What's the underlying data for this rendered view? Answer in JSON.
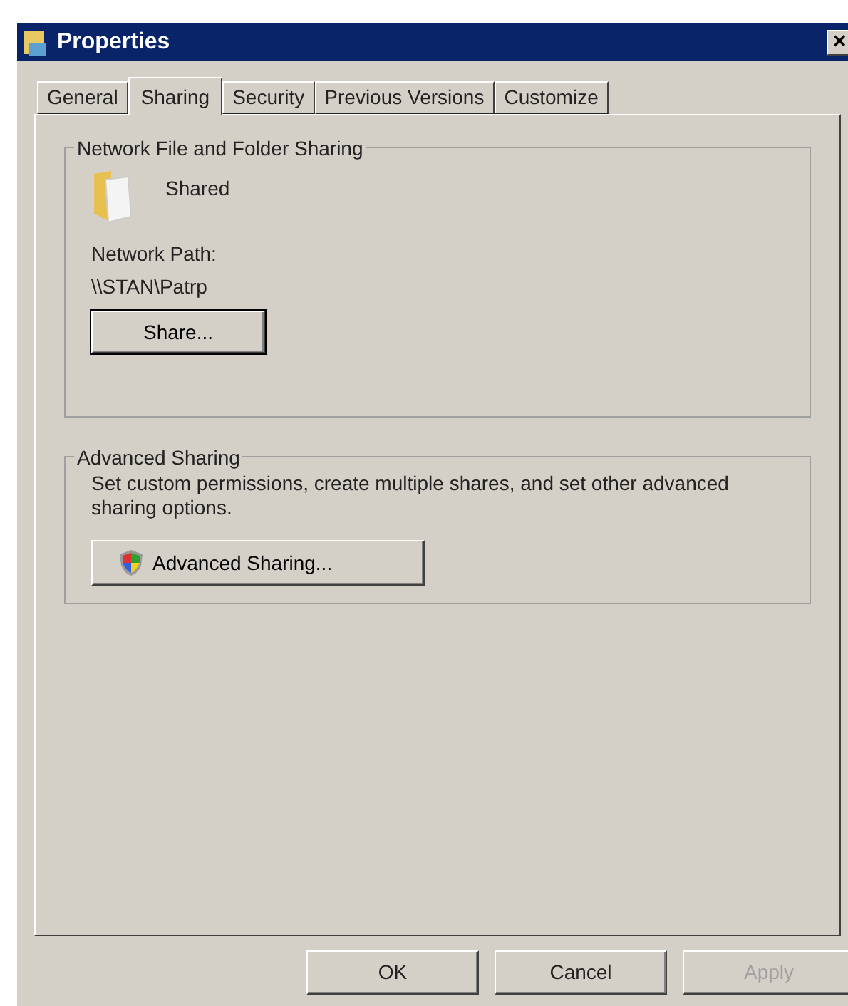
{
  "window": {
    "title": "Properties",
    "close": "×"
  },
  "tabs": [
    {
      "label": "General",
      "selected": false
    },
    {
      "label": "Sharing",
      "selected": true
    },
    {
      "label": "Security",
      "selected": false
    },
    {
      "label": "Previous Versions",
      "selected": false
    },
    {
      "label": "Customize",
      "selected": false
    }
  ],
  "network_sharing": {
    "title": "Network File and Folder Sharing",
    "status": "Shared",
    "path_label": "Network Path:",
    "path": "\\\\STAN\\Patrp",
    "button": "Share..."
  },
  "advanced_sharing": {
    "title": "Advanced Sharing",
    "description": "Set custom permissions, create multiple shares, and set other advanced sharing options.",
    "button": "Advanced Sharing..."
  },
  "buttons": [
    {
      "label": "OK",
      "disabled": false
    },
    {
      "label": "Cancel",
      "disabled": false
    },
    {
      "label": "Apply",
      "disabled": true
    }
  ]
}
